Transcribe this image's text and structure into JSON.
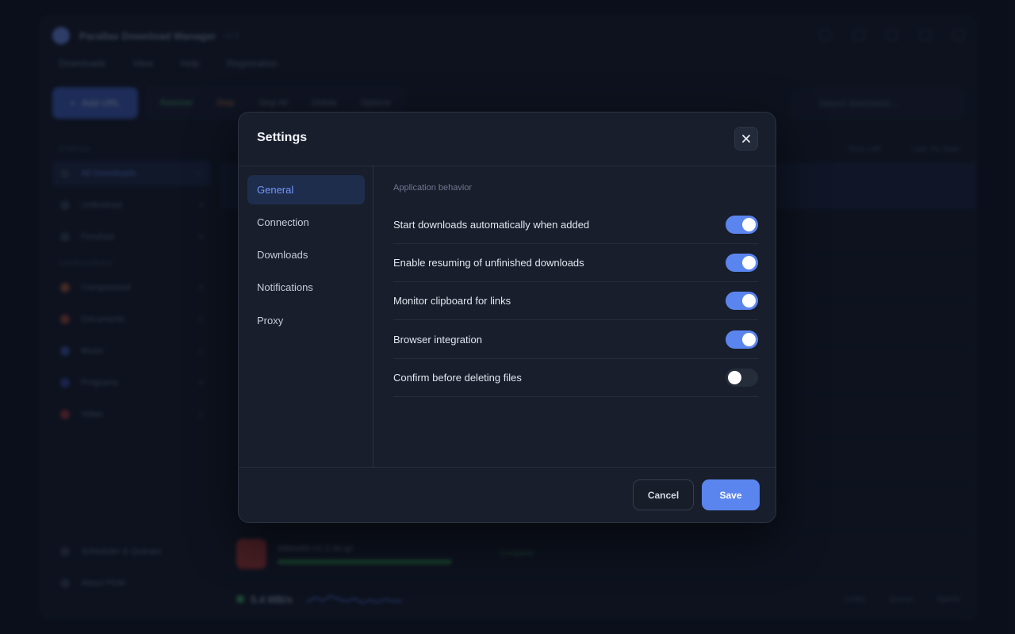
{
  "background_app": {
    "title": "Parallax Download Manager",
    "version": "v2.4",
    "menu": [
      "Downloads",
      "View",
      "Help",
      "Registration"
    ],
    "toolbar": {
      "add_label": "Add URL",
      "resume_label": "Resume",
      "stop_label": "Stop",
      "stop_all_label": "Stop All",
      "delete_label": "Delete",
      "options_label": "Options",
      "search_placeholder": "Search downloads..."
    },
    "sidebar": {
      "status_heading": "STATUS",
      "items": [
        {
          "label": "All Downloads",
          "count": "12"
        },
        {
          "label": "Unfinished",
          "count": "4"
        },
        {
          "label": "Finished",
          "count": "8"
        }
      ],
      "categories_heading": "CATEGORIES",
      "categories": [
        {
          "label": "Compressed",
          "count": "3"
        },
        {
          "label": "Documents",
          "count": "2"
        },
        {
          "label": "Music",
          "count": "1"
        },
        {
          "label": "Programs",
          "count": "4"
        },
        {
          "label": "Video",
          "count": "2"
        }
      ],
      "bottom_items": [
        "Scheduler & Queues",
        "About PDM"
      ]
    },
    "columns": [
      "Time Left",
      "Last Try Date"
    ],
    "last_row_name": "datasets-v1.2.tar.gz",
    "last_row_status": "Complete",
    "status_speed": "5.4 MB/s",
    "status_tabs": [
      "Limits",
      "Queue",
      "Speed"
    ]
  },
  "dialog": {
    "title": "Settings",
    "close_label": "×",
    "nav": [
      {
        "label": "General",
        "active": true
      },
      {
        "label": "Connection",
        "active": false
      },
      {
        "label": "Downloads",
        "active": false
      },
      {
        "label": "Notifications",
        "active": false
      },
      {
        "label": "Proxy",
        "active": false
      }
    ],
    "section_label": "Application behavior",
    "settings": [
      {
        "label": "Start downloads automatically when added",
        "enabled": true
      },
      {
        "label": "Enable resuming of unfinished downloads",
        "enabled": true
      },
      {
        "label": "Monitor clipboard for links",
        "enabled": true
      },
      {
        "label": "Browser integration",
        "enabled": true
      },
      {
        "label": "Confirm before deleting files",
        "enabled": false
      }
    ],
    "cancel_label": "Cancel",
    "save_label": "Save"
  },
  "colors": {
    "accent": "#5b85ee",
    "dialog_bg": "#181e2b",
    "page_bg": "#0d1220",
    "nav_active_bg": "#1f2d4d",
    "nav_active_text": "#7196ff"
  }
}
